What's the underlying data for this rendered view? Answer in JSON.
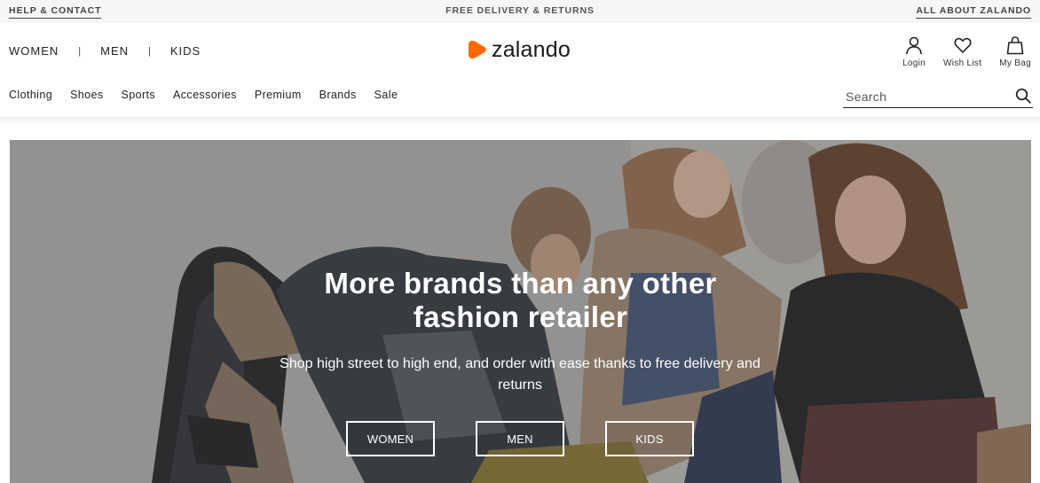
{
  "topbar": {
    "help": "HELP & CONTACT",
    "promo": "FREE DELIVERY & RETURNS",
    "about": "ALL ABOUT ZALANDO"
  },
  "gender_nav": {
    "items": [
      "WOMEN",
      "MEN",
      "KIDS"
    ],
    "separator": "|"
  },
  "logo": {
    "text": "zalando",
    "accent_color": "#ff6900"
  },
  "account": {
    "login": "Login",
    "wishlist": "Wish List",
    "bag": "My Bag"
  },
  "categories": [
    "Clothing",
    "Shoes",
    "Sports",
    "Accessories",
    "Premium",
    "Brands",
    "Sale"
  ],
  "search": {
    "placeholder": "Search"
  },
  "hero": {
    "title_line1": "More brands than any other",
    "title_line2": "fashion retailer",
    "subtitle": "Shop high street to high end, and order with ease thanks to free delivery and returns",
    "buttons": [
      "WOMEN",
      "MEN",
      "KIDS"
    ]
  },
  "icons": {
    "login": "user-icon",
    "wishlist": "heart-icon",
    "bag": "shopping-bag-icon",
    "search": "search-icon"
  }
}
